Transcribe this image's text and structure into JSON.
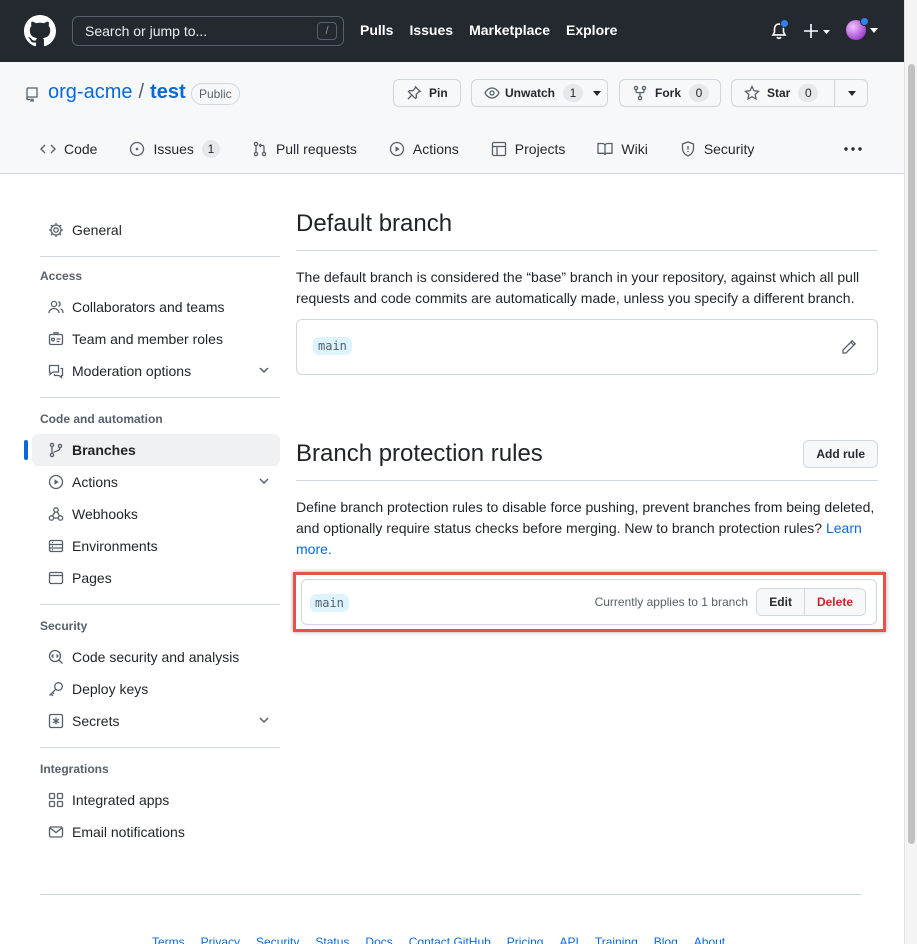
{
  "header": {
    "search_placeholder": "Search or jump to...",
    "search_shortcut": "/",
    "nav": [
      "Pulls",
      "Issues",
      "Marketplace",
      "Explore"
    ]
  },
  "repo": {
    "owner": "org-acme",
    "separator": "/",
    "name": "test",
    "visibility": "Public",
    "pin_label": "Pin",
    "unwatch_label": "Unwatch",
    "watch_count": "1",
    "fork_label": "Fork",
    "fork_count": "0",
    "star_label": "Star",
    "star_count": "0"
  },
  "tabs": [
    {
      "label": "Code",
      "icon": "code-icon"
    },
    {
      "label": "Issues",
      "icon": "issue-icon",
      "count": "1"
    },
    {
      "label": "Pull requests",
      "icon": "pull-request-icon"
    },
    {
      "label": "Actions",
      "icon": "play-icon"
    },
    {
      "label": "Projects",
      "icon": "table-icon"
    },
    {
      "label": "Wiki",
      "icon": "book-icon"
    },
    {
      "label": "Security",
      "icon": "shield-icon"
    }
  ],
  "sidebar": {
    "general": "General",
    "access_heading": "Access",
    "access": [
      "Collaborators and teams",
      "Team and member roles",
      "Moderation options"
    ],
    "code_heading": "Code and automation",
    "code": [
      "Branches",
      "Actions",
      "Webhooks",
      "Environments",
      "Pages"
    ],
    "security_heading": "Security",
    "security": [
      "Code security and analysis",
      "Deploy keys",
      "Secrets"
    ],
    "integrations_heading": "Integrations",
    "integrations": [
      "Integrated apps",
      "Email notifications"
    ]
  },
  "default_branch": {
    "title": "Default branch",
    "description": "The default branch is considered the “base” branch in your repository, against which all pull requests and code commits are automatically made, unless you specify a different branch.",
    "branch": "main"
  },
  "protection": {
    "title": "Branch protection rules",
    "add_rule": "Add rule",
    "description": "Define branch protection rules to disable force pushing, prevent branches from being deleted, and optionally require status checks before merging. New to branch protection rules?",
    "learn_more": "Learn more.",
    "rule_branch": "main",
    "applies": "Currently applies to 1 branch",
    "edit": "Edit",
    "delete": "Delete"
  },
  "footer": [
    "Terms",
    "Privacy",
    "Security",
    "Status",
    "Docs",
    "Contact GitHub",
    "Pricing",
    "API",
    "Training",
    "Blog",
    "About"
  ],
  "colors": {
    "accent": "#0969da",
    "header_bg": "#24292f",
    "danger": "#cf222e",
    "highlight": "#e5534b"
  }
}
